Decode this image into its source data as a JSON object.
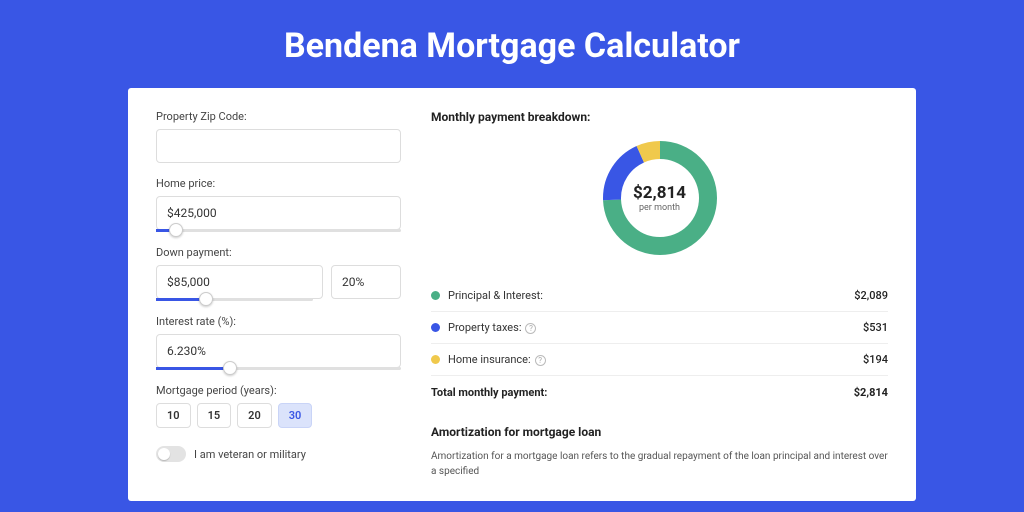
{
  "title": "Bendena Mortgage Calculator",
  "form": {
    "zip_label": "Property Zip Code:",
    "zip_value": "",
    "home_price_label": "Home price:",
    "home_price_value": "$425,000",
    "down_payment_label": "Down payment:",
    "down_payment_value": "$85,000",
    "down_payment_pct": "20%",
    "interest_label": "Interest rate (%):",
    "interest_value": "6.230%",
    "period_label": "Mortgage period (years):",
    "periods": [
      "10",
      "15",
      "20",
      "30"
    ],
    "period_active": "30",
    "veteran_label": "I am veteran or military"
  },
  "breakdown": {
    "title": "Monthly payment breakdown:",
    "center_amount": "$2,814",
    "center_sub": "per month",
    "rows": [
      {
        "label": "Principal & Interest:",
        "value": "$2,089",
        "color": "#4aaf86",
        "info": false
      },
      {
        "label": "Property taxes:",
        "value": "$531",
        "color": "#3956e5",
        "info": true
      },
      {
        "label": "Home insurance:",
        "value": "$194",
        "color": "#f0c94c",
        "info": true
      }
    ],
    "total_label": "Total monthly payment:",
    "total_value": "$2,814"
  },
  "amort": {
    "title": "Amortization for mortgage loan",
    "text": "Amortization for a mortgage loan refers to the gradual repayment of the loan principal and interest over a specified"
  },
  "chart_data": {
    "type": "pie",
    "title": "Monthly payment breakdown",
    "series": [
      {
        "name": "Principal & Interest",
        "value": 2089,
        "color": "#4aaf86"
      },
      {
        "name": "Property taxes",
        "value": 531,
        "color": "#3956e5"
      },
      {
        "name": "Home insurance",
        "value": 194,
        "color": "#f0c94c"
      }
    ],
    "total": 2814,
    "center_label": "$2,814 per month"
  }
}
